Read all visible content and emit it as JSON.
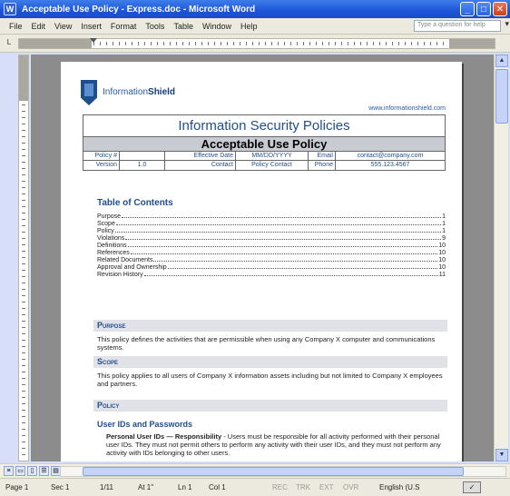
{
  "window": {
    "title": "Acceptable Use Policy - Express.doc - Microsoft Word",
    "app_icon": "word-icon"
  },
  "menu": [
    "File",
    "Edit",
    "View",
    "Insert",
    "Format",
    "Tools",
    "Table",
    "Window",
    "Help"
  ],
  "help_box": {
    "placeholder": "Type a question for help"
  },
  "document": {
    "logo_text_light": "Information",
    "logo_text_bold": "Shield",
    "site_url": "www.informationshield.com",
    "header": {
      "title": "Information Security Policies",
      "subtitle": "Acceptable Use Policy",
      "row1": {
        "policy_label": "Policy #",
        "policy_value": "",
        "effective_label": "Effective Date",
        "effective_value": "MM/DD/YYYY",
        "email_label": "Email",
        "email_value": "contact@company.com"
      },
      "row2": {
        "version_label": "Version",
        "version_value": "1.0",
        "contact_label": "Contact",
        "contact_value": "Policy Contact",
        "phone_label": "Phone",
        "phone_value": "555.123.4567"
      }
    },
    "toc_heading": "Table of Contents",
    "toc": [
      {
        "label": "Purpose",
        "page": "1"
      },
      {
        "label": "Scope",
        "page": "1"
      },
      {
        "label": "Policy",
        "page": "1"
      },
      {
        "label": "Violations",
        "page": "9"
      },
      {
        "label": "Definitions",
        "page": "10"
      },
      {
        "label": "References",
        "page": "10"
      },
      {
        "label": "Related Documents",
        "page": "10"
      },
      {
        "label": "Approval and Ownership",
        "page": "10"
      },
      {
        "label": "Revision History",
        "page": "11"
      }
    ],
    "purpose_heading": "Purpose",
    "purpose_text": "This policy defines the activities that are permissible when using any Company X computer and communications systems.",
    "scope_heading": "Scope",
    "scope_text": "This policy applies to all users of Company X information assets including but not limited to Company X employees and partners.",
    "policy_heading": "Policy",
    "user_ids_heading": "User IDs and Passwords",
    "user_ids_lead": "Personal User IDs — Responsibility",
    "user_ids_text": " - Users must be responsible for all activity performed with their personal user IDs. They must not permit others to perform any activity with their user IDs, and they must not perform any activity with IDs belonging to other users."
  },
  "status": {
    "page": "Page 1",
    "sec": "Sec 1",
    "pages": "1/11",
    "at": "At 1\"",
    "ln": "Ln 1",
    "col": "Col 1",
    "rec": "REC",
    "trk": "TRK",
    "ext": "EXT",
    "ovr": "OVR",
    "language": "English (U.S"
  }
}
